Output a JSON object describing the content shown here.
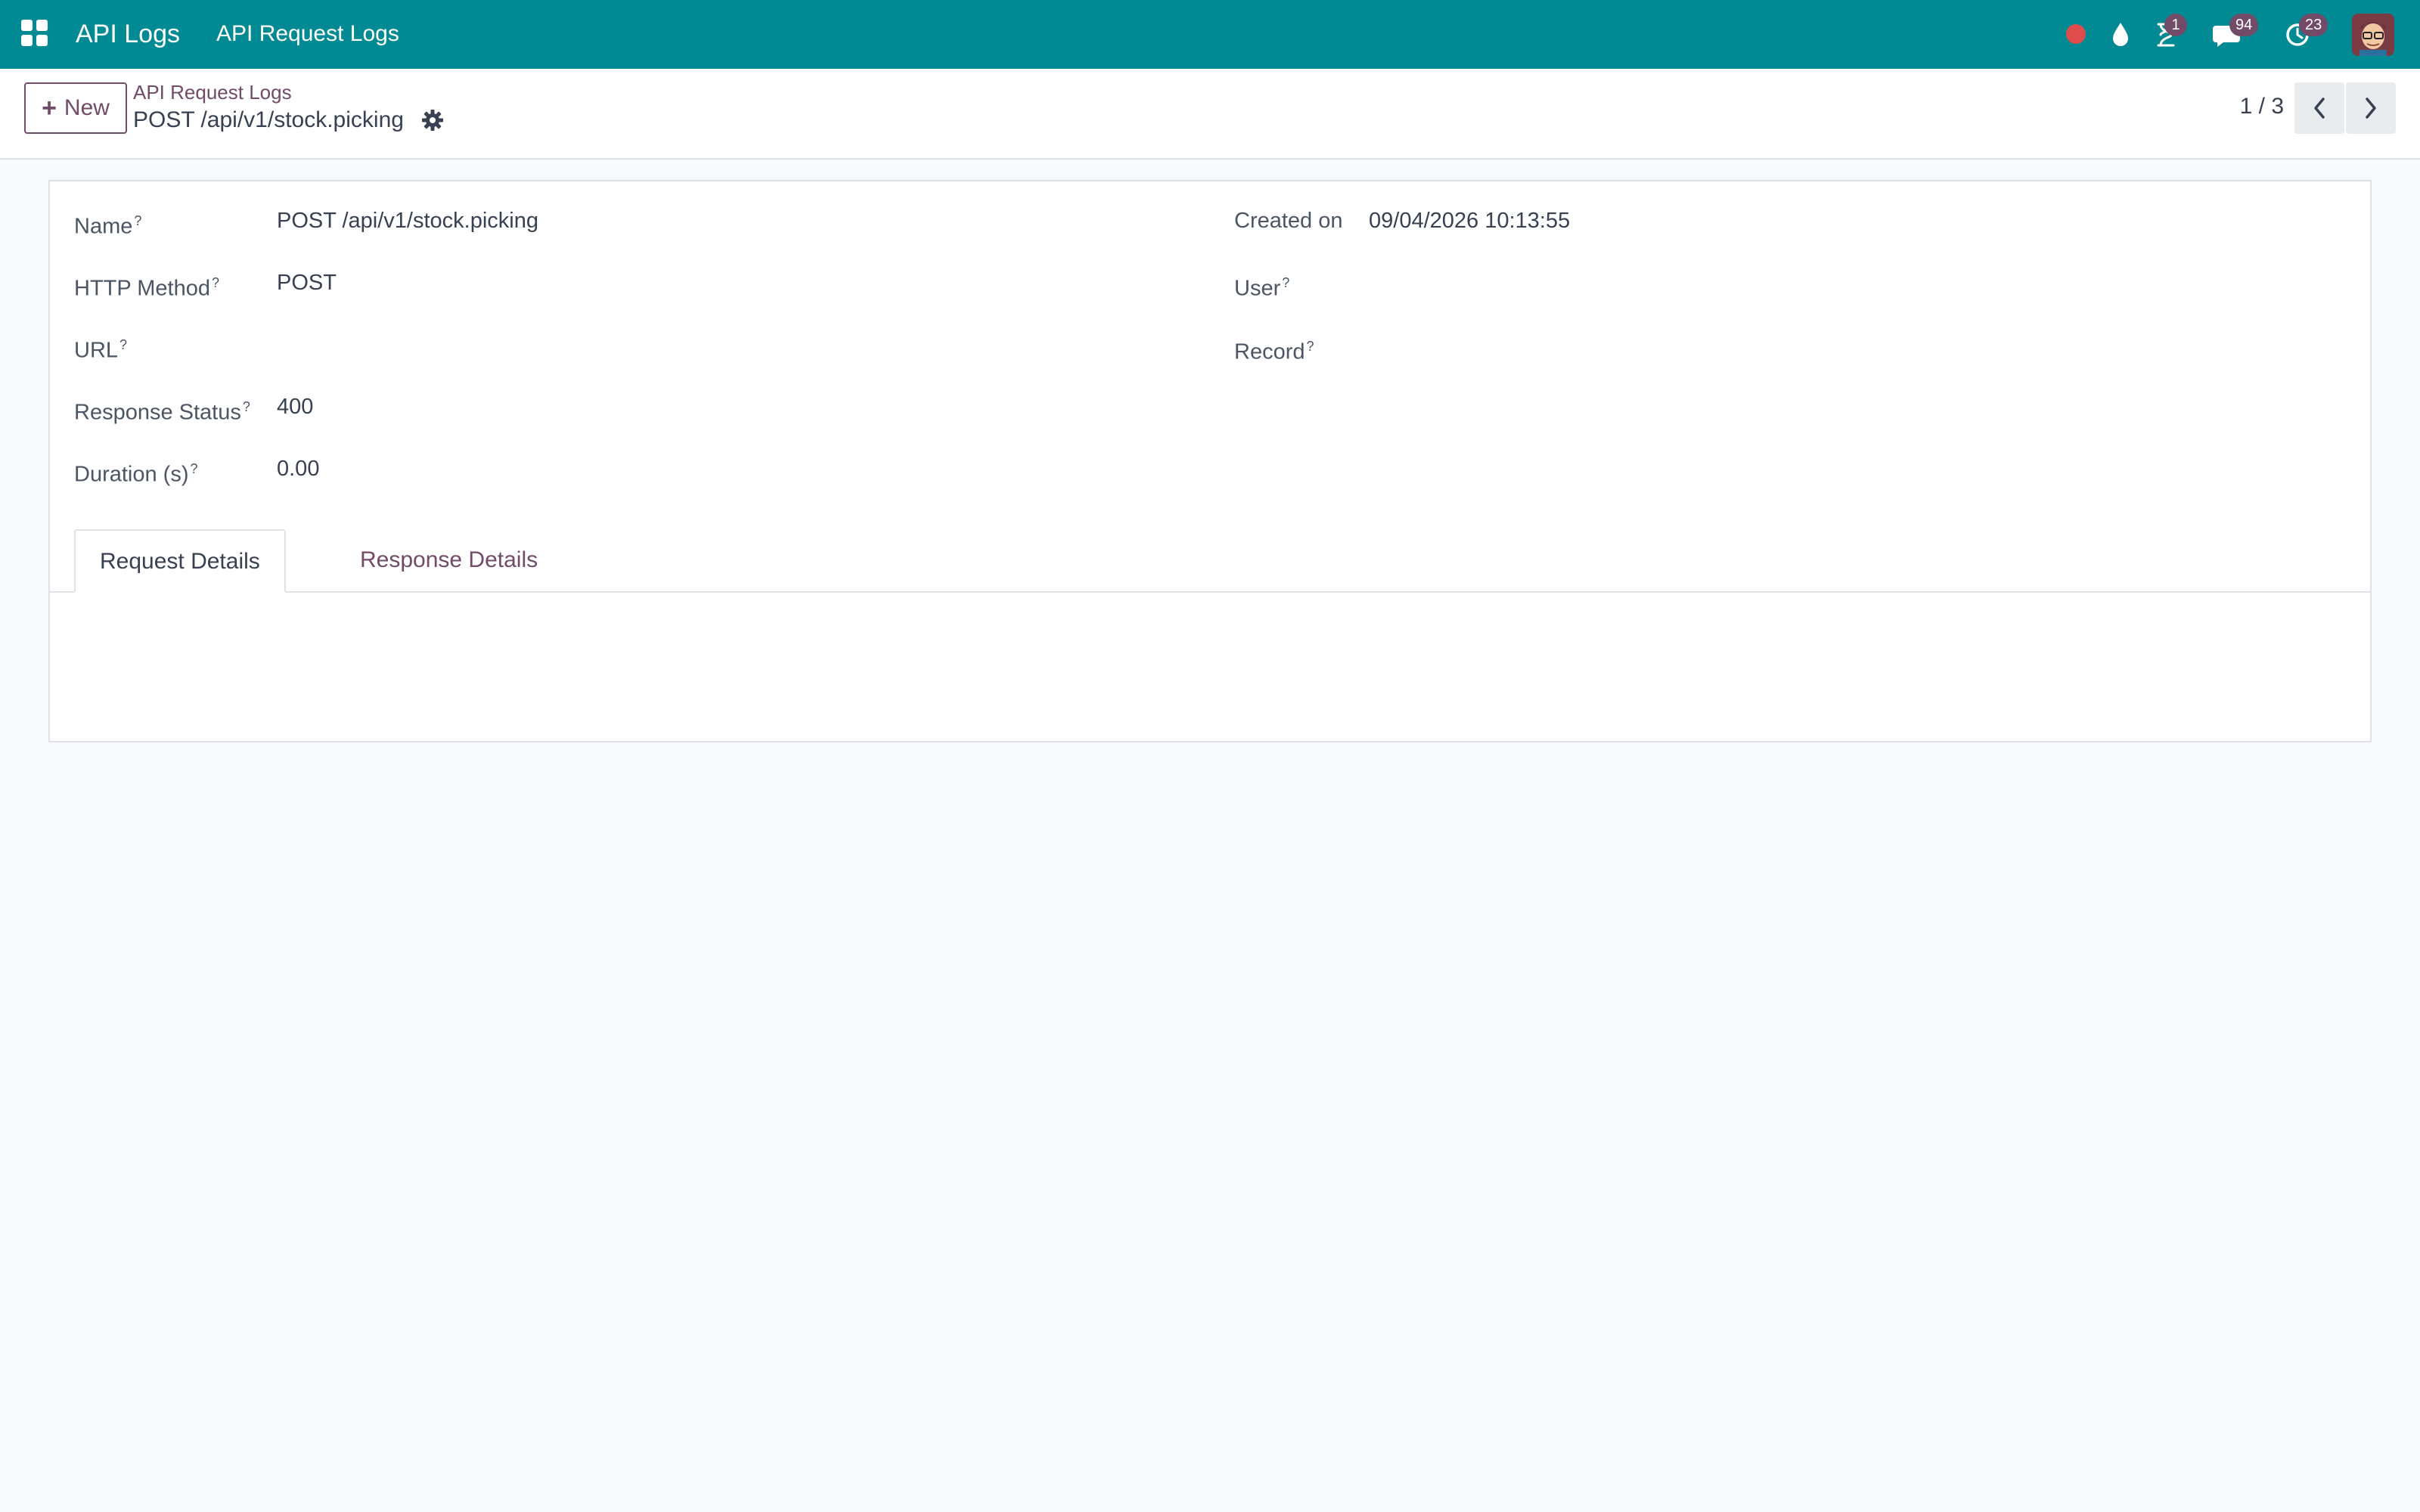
{
  "navbar": {
    "app_name": "API Logs",
    "menu_item": "API Request Logs",
    "background_color": "#018a93",
    "systray": {
      "recording_indicator_color": "#e04c4c",
      "activity_badge": "1",
      "messages_badge": "94",
      "updates_badge": "23",
      "badge_color": "#714b67"
    }
  },
  "control_panel": {
    "new_button_label": "New",
    "breadcrumb": "API Request Logs",
    "record_title": "POST /api/v1/stock.picking",
    "pager": "1 / 3"
  },
  "form": {
    "left_fields": [
      {
        "label": "Name",
        "help": "?",
        "value": "POST /api/v1/stock.picking"
      },
      {
        "label": "HTTP Method",
        "help": "?",
        "value": "POST"
      },
      {
        "label": "URL",
        "help": "?",
        "value": ""
      },
      {
        "label": "Response Status",
        "help": "?",
        "value": "400"
      },
      {
        "label": "Duration (s)",
        "help": "?",
        "value": "0.00"
      }
    ],
    "right_fields": [
      {
        "label": "Created on",
        "help": "",
        "value": "09/04/2026 10:13:55"
      },
      {
        "label": "User",
        "help": "?",
        "value": ""
      },
      {
        "label": "Record",
        "help": "?",
        "value": ""
      }
    ],
    "tabs": [
      {
        "label": "Request Details",
        "active": true
      },
      {
        "label": "Response Details",
        "active": false
      }
    ]
  },
  "accent_color": "#714b67"
}
